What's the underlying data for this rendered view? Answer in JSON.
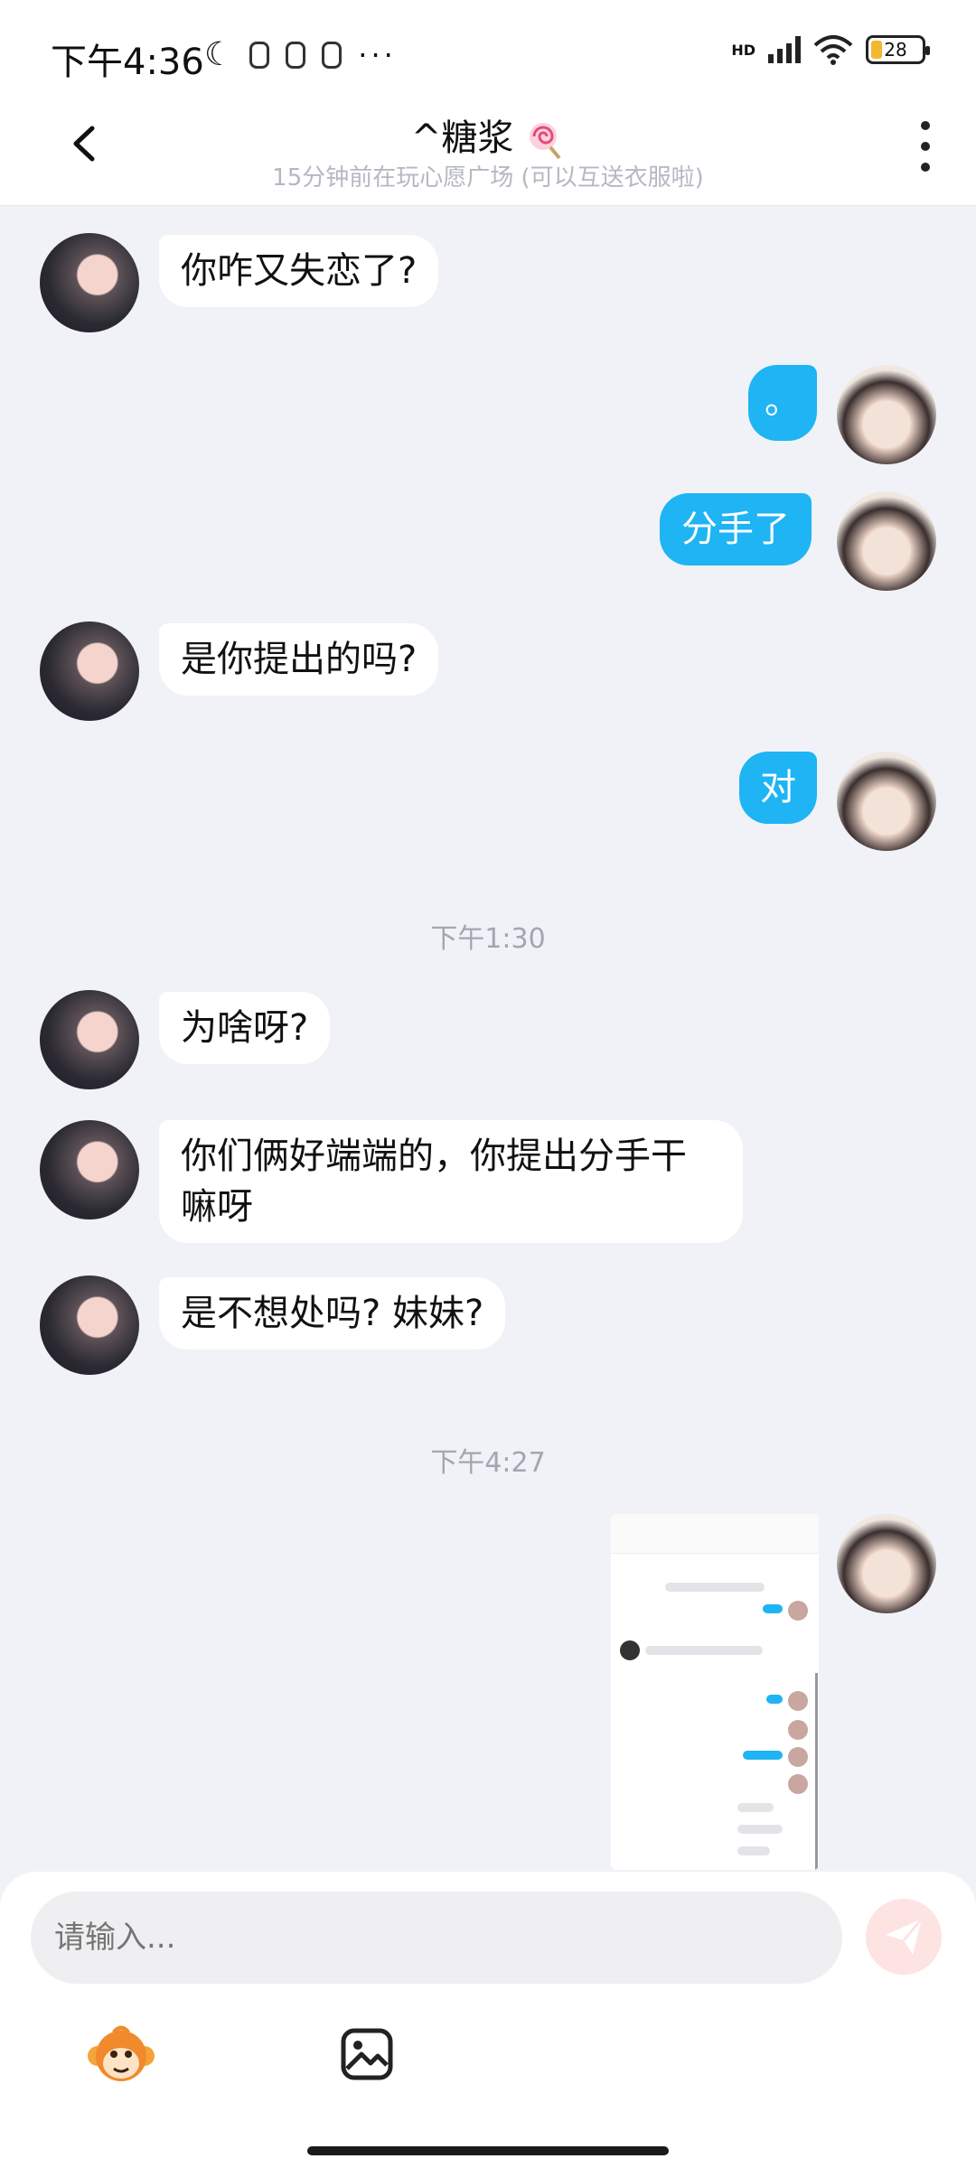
{
  "status_bar": {
    "time": "下午4:36",
    "dots": "···",
    "network": "HD",
    "battery": "28"
  },
  "header": {
    "title": "^糖浆",
    "subtitle": "15分钟前在玩心愿广场 (可以互送衣服啦)"
  },
  "messages": [
    {
      "from": "other",
      "text": "你咋又失恋了?"
    },
    {
      "from": "me",
      "text": "。"
    },
    {
      "from": "me",
      "text": "分手了"
    },
    {
      "from": "other",
      "text": "是你提出的吗?"
    },
    {
      "from": "me",
      "text": "对"
    },
    {
      "from": "other",
      "text": "为啥呀?"
    },
    {
      "from": "other",
      "text": "你们俩好端端的，你提出分手干嘛呀"
    },
    {
      "from": "other",
      "text": "是不想处吗? 妹妹?"
    },
    {
      "from": "me",
      "type": "image",
      "text": ""
    }
  ],
  "timestamps": [
    "下午1:30",
    "下午4:27"
  ],
  "input": {
    "placeholder": "请输入..."
  },
  "colors": {
    "my_bubble": "#1fb4f3",
    "other_bubble": "#ffffff",
    "background": "#f0f2f8",
    "send_button": "#fde3e2"
  },
  "icons": [
    "back-arrow-icon",
    "more-vertical-icon",
    "send-icon",
    "monkey-emoji-icon",
    "image-icon"
  ]
}
